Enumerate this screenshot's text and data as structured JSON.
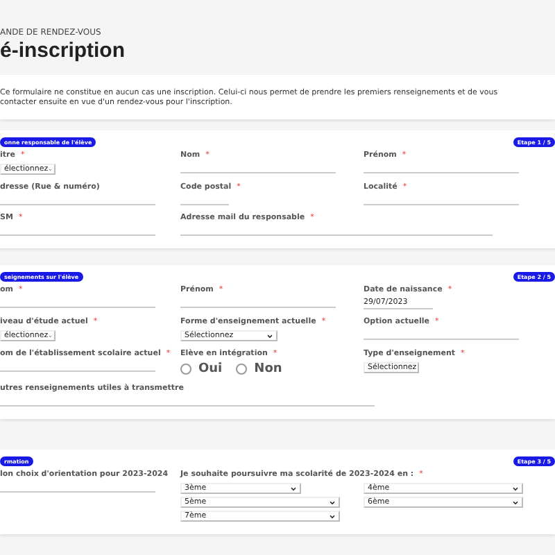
{
  "header": {
    "overline": "ANDE DE RENDEZ-VOUS",
    "title": "é-inscription"
  },
  "notice": "Ce formulaire ne constitue en aucun cas une inscription. Celui-ci nous permet de prendre les premiers renseignements et de vous contacter ensuite en vue d'un rendez-vous pour l'inscription.",
  "sections": [
    {
      "badge": "onne responsable de l'élève",
      "step": "Etape 1 / 5",
      "fields": [
        {
          "kind": "select",
          "label": "itre",
          "mark": "*",
          "value": "électionnez"
        },
        {
          "kind": "text",
          "label": "Nom",
          "mark": "*"
        },
        {
          "kind": "text",
          "label": "Prénom",
          "mark": "*"
        },
        {
          "kind": "text",
          "label": "dresse (Rue & numéro)"
        },
        {
          "kind": "text",
          "label": "Code postal",
          "mark": "*"
        },
        {
          "kind": "text",
          "label": "Localité",
          "mark": "*"
        },
        {
          "kind": "text",
          "label": "SM",
          "mark": "*"
        },
        {
          "kind": "text",
          "label": "Adresse mail du responsable",
          "mark": "*"
        }
      ]
    },
    {
      "badge": "seignements sur l'élève",
      "step": "Etape 2 / 5",
      "fields": [
        {
          "kind": "text",
          "label": "om",
          "mark": "*"
        },
        {
          "kind": "text",
          "label": "Prénom",
          "mark": "*"
        },
        {
          "kind": "date",
          "label": "Date de naissance",
          "mark": "*",
          "value": "29/07/2023"
        },
        {
          "kind": "select",
          "label": "iveau d'étude actuel",
          "mark": "*",
          "value": "électionnez"
        },
        {
          "kind": "select",
          "label": "Forme d'enseignement actuelle",
          "mark": "*",
          "value": "Sélectionnez"
        },
        {
          "kind": "text",
          "label": "Option actuelle",
          "mark": "*"
        },
        {
          "kind": "text",
          "label": "om de l'établissement scolaire actuel",
          "mark": "*"
        },
        {
          "kind": "radio",
          "label": "Elève en intégration",
          "mark": "*",
          "options": [
            {
              "label": "Oui",
              "selected": false
            },
            {
              "label": "Non",
              "selected": false
            }
          ]
        },
        {
          "kind": "select",
          "label": "Type d'enseignement",
          "mark": "*",
          "value": "Sélectionnez"
        },
        {
          "kind": "text",
          "label": "utres renseignements utiles à transmettre"
        }
      ]
    },
    {
      "badge": "rmation",
      "step": "Etape 3 / 5",
      "fields": [
        {
          "kind": "text",
          "label": "lon choix d'orientation pour 2023-2024"
        },
        {
          "kind": "selectgroup",
          "label": "Je souhaite poursuivre ma scolarité de 2023-2024 en :",
          "mark": "*",
          "values": [
            "3ème",
            "4ème",
            "5ème",
            "6ème",
            "7ème"
          ]
        }
      ]
    }
  ]
}
